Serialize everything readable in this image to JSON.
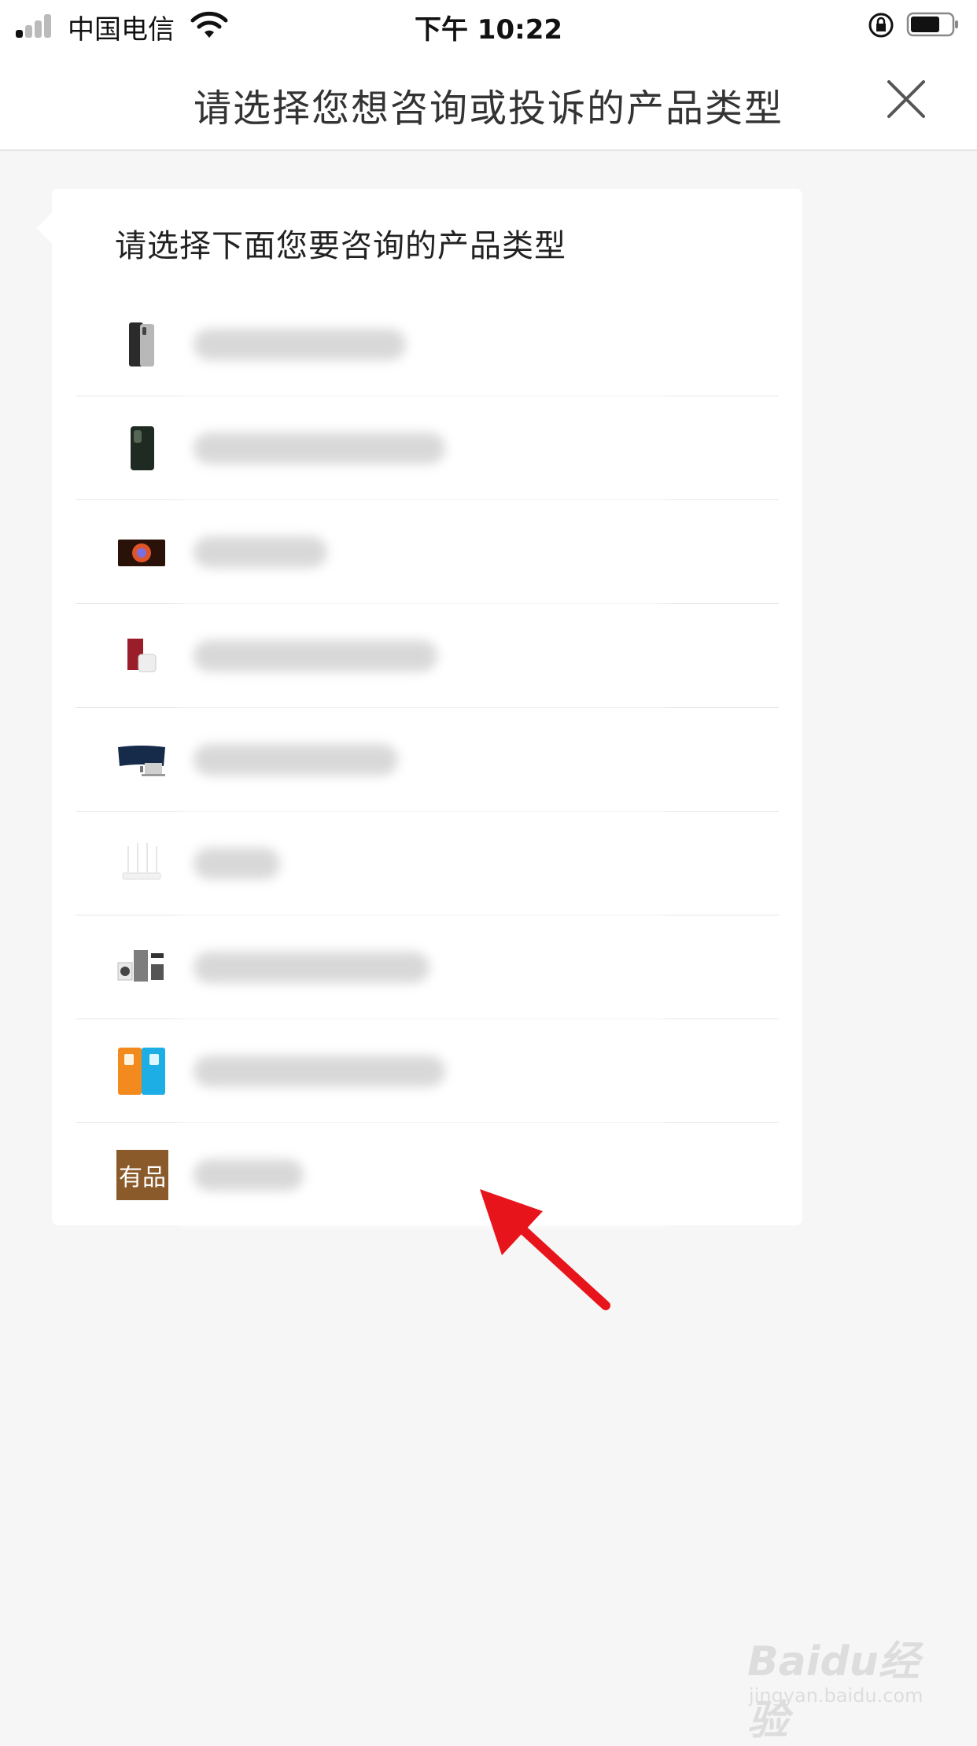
{
  "status_bar": {
    "carrier": "中国电信",
    "time": "下午 10:22",
    "icons": [
      "signal-icon",
      "wifi-icon",
      "orientation-lock-icon",
      "battery-icon"
    ]
  },
  "nav": {
    "title": "请选择您想咨询或投诉的产品类型",
    "close_icon": "close-icon"
  },
  "card": {
    "title": "请选择下面您要咨询的产品类型",
    "items": [
      {
        "thumb": "phone-silver-thumbnail",
        "label": ""
      },
      {
        "thumb": "phone-dark-thumbnail",
        "label": ""
      },
      {
        "thumb": "tv-thumbnail",
        "label": ""
      },
      {
        "thumb": "red-box-product-thumbnail",
        "label": ""
      },
      {
        "thumb": "monitor-laptop-thumbnail",
        "label": ""
      },
      {
        "thumb": "router-thumbnail",
        "label": ""
      },
      {
        "thumb": "home-appliance-thumbnail",
        "label": ""
      },
      {
        "thumb": "sim-card-thumbnail",
        "label": ""
      },
      {
        "thumb": "youpin-logo",
        "label": "",
        "badge_text": "有品"
      }
    ]
  },
  "watermark": {
    "main": "Baidu经验",
    "sub": "jingyan.baidu.com"
  },
  "colors": {
    "background": "#f6f6f6",
    "card": "#ffffff",
    "youpin_brown": "#8a5a2b",
    "annotation_arrow": "#e8141b"
  }
}
